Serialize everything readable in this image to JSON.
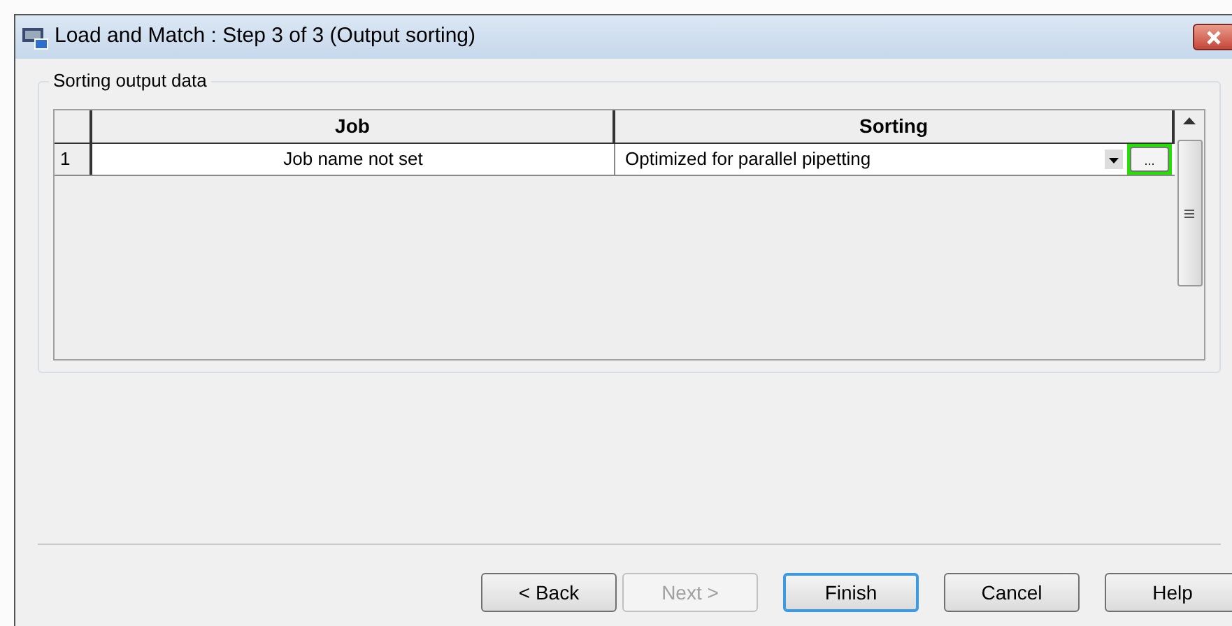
{
  "window": {
    "title": "Load and Match : Step 3 of 3 (Output sorting)"
  },
  "group": {
    "title": "Sorting output data"
  },
  "table": {
    "columns": [
      "Job",
      "Sorting"
    ],
    "rows": [
      {
        "index": "1",
        "job": "Job name not set",
        "sorting": "Optimized for parallel pipetting",
        "ellipsis": "...",
        "highlighted": true
      }
    ]
  },
  "buttons": [
    {
      "label": "< Back",
      "disabled": false,
      "default": false
    },
    {
      "label": "Next >",
      "disabled": true,
      "default": false
    },
    {
      "label": "Finish",
      "disabled": false,
      "default": true
    },
    {
      "label": "Cancel",
      "disabled": false,
      "default": false
    },
    {
      "label": "Help",
      "disabled": false,
      "default": false
    }
  ]
}
